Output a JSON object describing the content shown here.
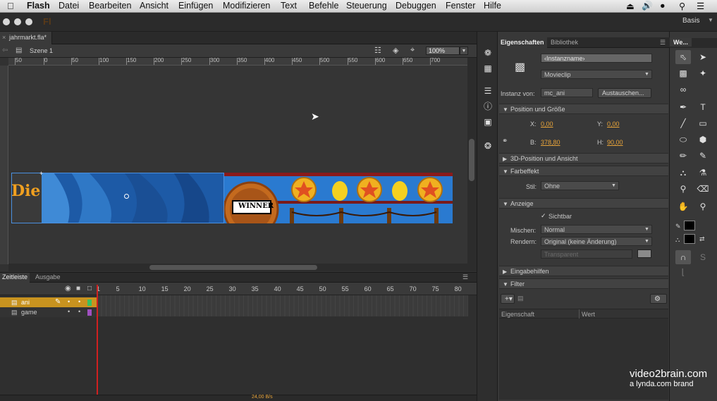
{
  "menubar": {
    "apple": "",
    "app": "Flash",
    "items": [
      "Datei",
      "Bearbeiten",
      "Ansicht",
      "Einfügen",
      "Modifizieren",
      "Text",
      "Befehle",
      "Steuerung",
      "Debuggen",
      "Fenster",
      "Hilfe"
    ]
  },
  "appbar": {
    "logo": "Fl",
    "workspace": "Basis"
  },
  "document": {
    "tab": "jahrmarkt.fla*",
    "scene": "Szene 1",
    "zoom": "100%"
  },
  "ruler": {
    "labels": [
      "50",
      "0",
      "50",
      "100",
      "150",
      "200",
      "250",
      "300",
      "350",
      "400",
      "450",
      "500",
      "550",
      "600",
      "650",
      "700"
    ]
  },
  "stage": {
    "banner_text": "Die",
    "sign_text": "WINNER"
  },
  "timeline": {
    "tabs": [
      "Zeitleiste",
      "Ausgabe"
    ],
    "frame_numbers": [
      "1",
      "5",
      "10",
      "15",
      "20",
      "25",
      "30",
      "35",
      "40",
      "45",
      "50",
      "55",
      "60",
      "65",
      "70",
      "75",
      "80"
    ],
    "layers": [
      {
        "name": "ani",
        "selected": true,
        "color": "#38c060"
      },
      {
        "name": "game",
        "selected": false,
        "color": "#a050c0"
      }
    ],
    "footer": "24,00 B/s"
  },
  "properties": {
    "tabs": [
      "Eigenschaften",
      "Bibliothek"
    ],
    "instance_name_placeholder": "‹Instanzname›",
    "type": "Movieclip",
    "instance_of_label": "Instanz von:",
    "instance_of": "mc_ani",
    "swap_button": "Austauschen...",
    "sections": {
      "position": "Position und Größe",
      "threed": "3D-Position und Ansicht",
      "color": "Farbeffekt",
      "display": "Anzeige",
      "accessibility": "Eingabehilfen",
      "filter": "Filter"
    },
    "x_label": "X:",
    "x": "0,00",
    "y_label": "Y:",
    "y": "0,00",
    "w_label": "B:",
    "w": "378,80",
    "h_label": "H:",
    "h": "90,00",
    "style_label": "Stil:",
    "style": "Ohne",
    "visible_label": "Sichtbar",
    "blend_label": "Mischen:",
    "blend": "Normal",
    "render_label": "Rendern:",
    "render": "Original (keine Änderung)",
    "transparent": "Transparent",
    "filter_col1": "Eigenschaft",
    "filter_col2": "Wert"
  },
  "tools": {
    "tab": "We..."
  },
  "watermark": {
    "line1": "video2brain.com",
    "line2": "a lynda.com brand"
  },
  "colors": {
    "accent": "#e8a43a",
    "selection": "#c8931f",
    "playhead": "#d02020"
  }
}
